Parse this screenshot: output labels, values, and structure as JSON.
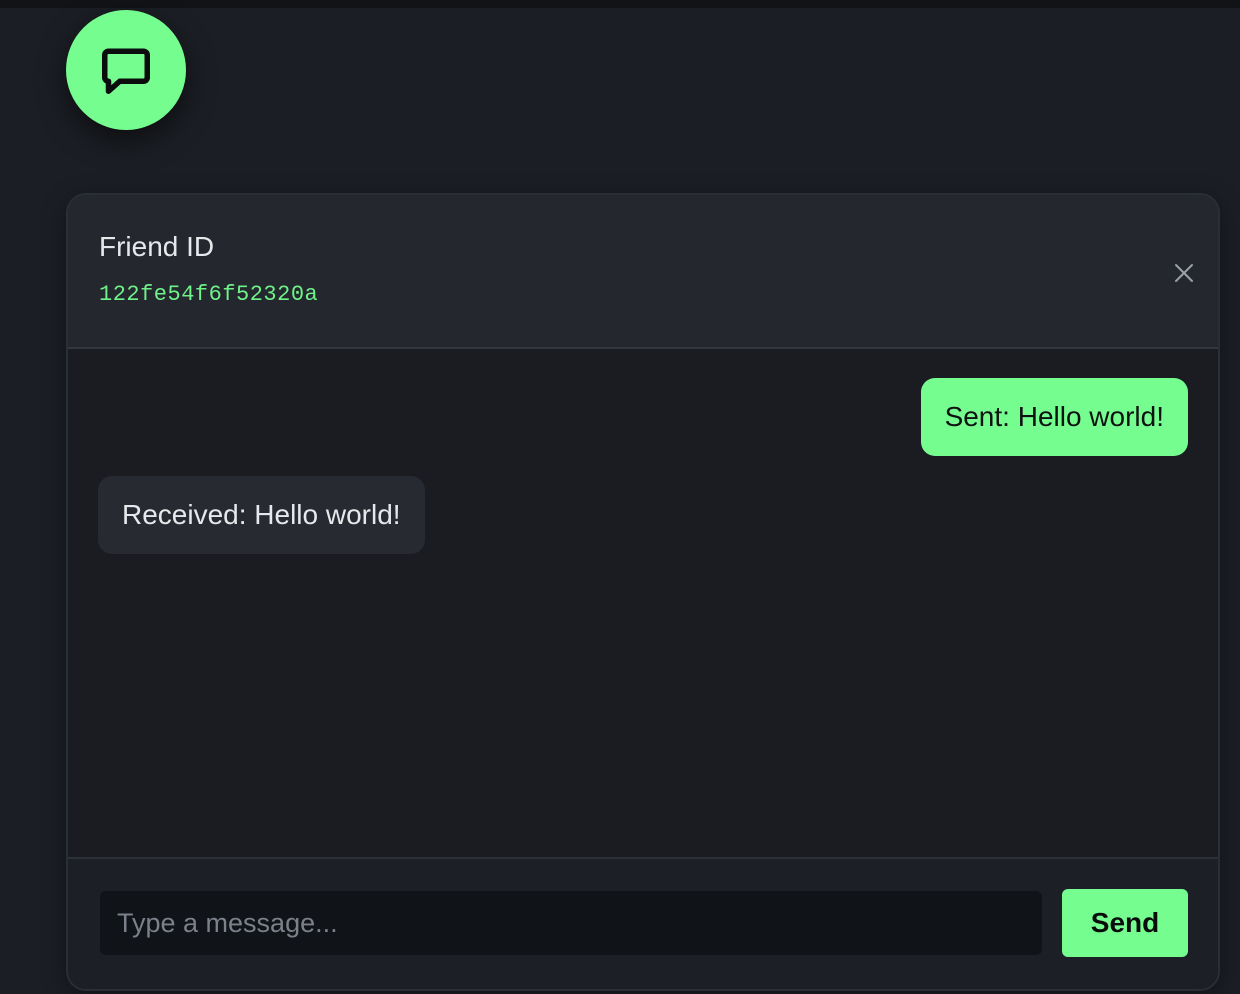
{
  "launcher": {
    "icon": "chat-bubble-icon"
  },
  "chat": {
    "header_title": "Friend ID",
    "friend_id": "122fe54f6f52320a",
    "close_icon": "close-icon"
  },
  "messages": [
    {
      "direction": "sent",
      "text": "Sent: Hello world!"
    },
    {
      "direction": "received",
      "text": "Received: Hello world!"
    }
  ],
  "composer": {
    "placeholder": "Type a message...",
    "value": "",
    "send_label": "Send"
  },
  "colors": {
    "accent": "#75fd90",
    "background": "#1b1e24",
    "panel_header": "#24272d",
    "received_bubble": "#272a30",
    "id_text": "#6ef28a"
  }
}
